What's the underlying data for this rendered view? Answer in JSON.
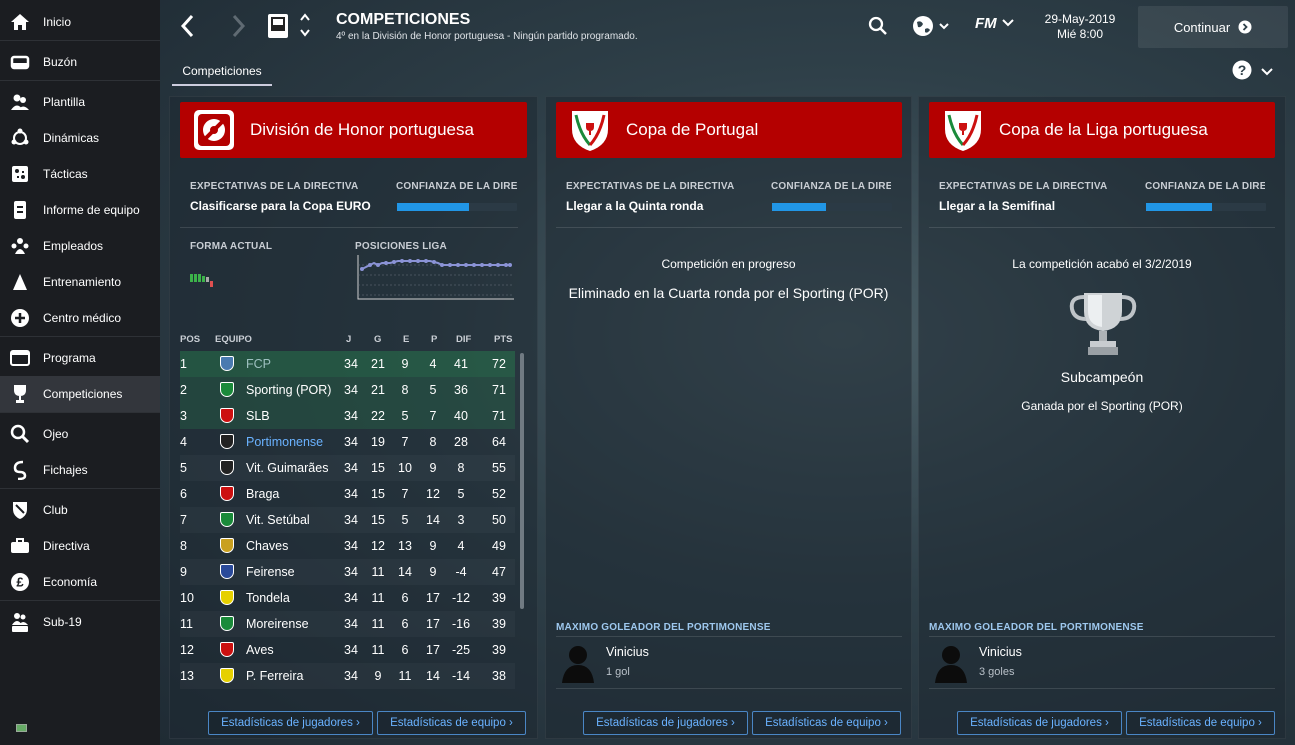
{
  "sidebar": {
    "items": [
      {
        "label": "Inicio",
        "icon": "home-icon"
      },
      {
        "label": "Buzón",
        "icon": "inbox-icon"
      },
      {
        "label": "Plantilla",
        "icon": "squad-icon"
      },
      {
        "label": "Dinámicas",
        "icon": "dynamics-icon"
      },
      {
        "label": "Tácticas",
        "icon": "tactics-icon"
      },
      {
        "label": "Informe de equipo",
        "icon": "report-icon"
      },
      {
        "label": "Empleados",
        "icon": "staff-icon"
      },
      {
        "label": "Entrenamiento",
        "icon": "training-icon"
      },
      {
        "label": "Centro médico",
        "icon": "medical-icon"
      },
      {
        "label": "Programa",
        "icon": "schedule-icon"
      },
      {
        "label": "Competiciones",
        "icon": "trophy-icon"
      },
      {
        "label": "Ojeo",
        "icon": "scouting-icon"
      },
      {
        "label": "Fichajes",
        "icon": "transfers-icon"
      },
      {
        "label": "Club",
        "icon": "club-icon"
      },
      {
        "label": "Directiva",
        "icon": "board-icon"
      },
      {
        "label": "Economía",
        "icon": "finance-icon"
      },
      {
        "label": "Sub-19",
        "icon": "u19-icon"
      }
    ]
  },
  "header": {
    "title": "COMPETICIONES",
    "subtitle": "4º en la División de Honor portuguesa - Ningún partido programado.",
    "date": "29-May-2019",
    "time": "Mié 8:00",
    "continue_label": "Continuar",
    "fm_logo": "FM"
  },
  "subtabs": {
    "competitions": "Competiciones"
  },
  "panel1": {
    "title": "División de Honor portuguesa",
    "exp_label": "EXPECTATIVAS DE LA DIRECTIVA",
    "exp_value": "Clasificarse para la Copa EURO",
    "conf_label": "CONFIANZA DE LA DIRECTIVA",
    "conf_level": 0.6,
    "form_label": "FORMA ACTUAL",
    "pos_label": "POSICIONES LIGA",
    "headers": {
      "pos": "POS",
      "team": "EQUIPO",
      "j": "J",
      "g": "G",
      "e": "E",
      "p": "P",
      "dif": "DIF",
      "pts": "PTS"
    },
    "rows": [
      [
        "1",
        "FCP",
        "34",
        "21",
        "9",
        "4",
        "41",
        "72"
      ],
      [
        "2",
        "Sporting (POR)",
        "34",
        "21",
        "8",
        "5",
        "36",
        "71"
      ],
      [
        "3",
        "SLB",
        "34",
        "22",
        "5",
        "7",
        "40",
        "71"
      ],
      [
        "4",
        "Portimonense",
        "34",
        "19",
        "7",
        "8",
        "28",
        "64"
      ],
      [
        "5",
        "Vit. Guimarães",
        "34",
        "15",
        "10",
        "9",
        "8",
        "55"
      ],
      [
        "6",
        "Braga",
        "34",
        "15",
        "7",
        "12",
        "5",
        "52"
      ],
      [
        "7",
        "Vit. Setúbal",
        "34",
        "15",
        "5",
        "14",
        "3",
        "50"
      ],
      [
        "8",
        "Chaves",
        "34",
        "12",
        "13",
        "9",
        "4",
        "49"
      ],
      [
        "9",
        "Feirense",
        "34",
        "11",
        "14",
        "9",
        "-4",
        "47"
      ],
      [
        "10",
        "Tondela",
        "34",
        "11",
        "6",
        "17",
        "-12",
        "39"
      ],
      [
        "11",
        "Moreirense",
        "34",
        "11",
        "6",
        "17",
        "-16",
        "39"
      ],
      [
        "12",
        "Aves",
        "34",
        "11",
        "6",
        "17",
        "-25",
        "39"
      ],
      [
        "13",
        "P. Ferreira",
        "34",
        "9",
        "11",
        "14",
        "-14",
        "38"
      ]
    ],
    "btn_players": "Estadísticas de jugadores",
    "btn_team": "Estadísticas de equipo"
  },
  "panel2": {
    "title": "Copa de Portugal",
    "exp_label": "EXPECTATIVAS DE LA DIRECTIVA",
    "exp_value": "Llegar a la Quinta ronda",
    "conf_label": "CONFIANZA DE LA DIRECTIVA",
    "conf_level": 0.45,
    "status": "Competición en progreso",
    "result": "Eliminado en la Cuarta ronda por el Sporting (POR)",
    "scorer_label": "MÁXIMO GOLEADOR DEL PORTIMONENSE",
    "scorer_name": "Vinicius",
    "scorer_goals": "1 gol",
    "btn_players": "Estadísticas de jugadores",
    "btn_team": "Estadísticas de equipo"
  },
  "panel3": {
    "title": "Copa de la Liga portuguesa",
    "exp_label": "EXPECTATIVAS DE LA DIRECTIVA",
    "exp_value": "Llegar a la Semifinal",
    "conf_label": "CONFIANZA DE LA DIRECTIVA",
    "conf_level": 0.55,
    "status": "La competición acabó el 3/2/2019",
    "placement": "Subcampeón",
    "winner": "Ganada por el Sporting (POR)",
    "scorer_label": "MÁXIMO GOLEADOR DEL PORTIMONENSE",
    "scorer_name": "Vinicius",
    "scorer_goals": "3 goles",
    "btn_players": "Estadísticas de jugadores",
    "btn_team": "Estadísticas de equipo"
  },
  "colors": {
    "accent": "#b40000",
    "link": "#6ab2ff",
    "bar": "#2196e6",
    "highlight": "#6ab2ff"
  }
}
